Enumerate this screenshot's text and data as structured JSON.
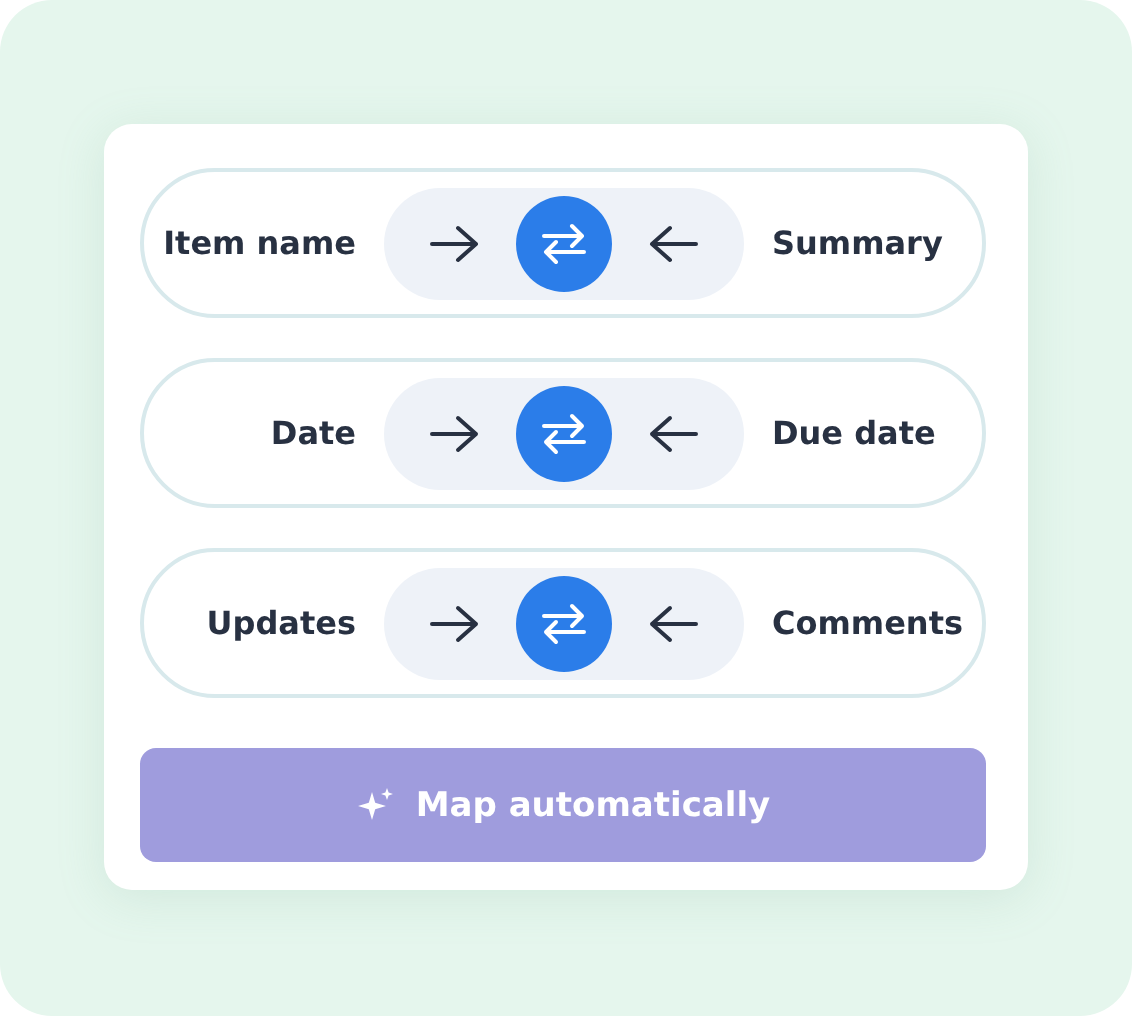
{
  "mappings": [
    {
      "source": "Item name",
      "target": "Summary"
    },
    {
      "source": "Date",
      "target": "Due date"
    },
    {
      "source": "Updates",
      "target": "Comments"
    }
  ],
  "action_button": {
    "label": "Map automatically"
  }
}
